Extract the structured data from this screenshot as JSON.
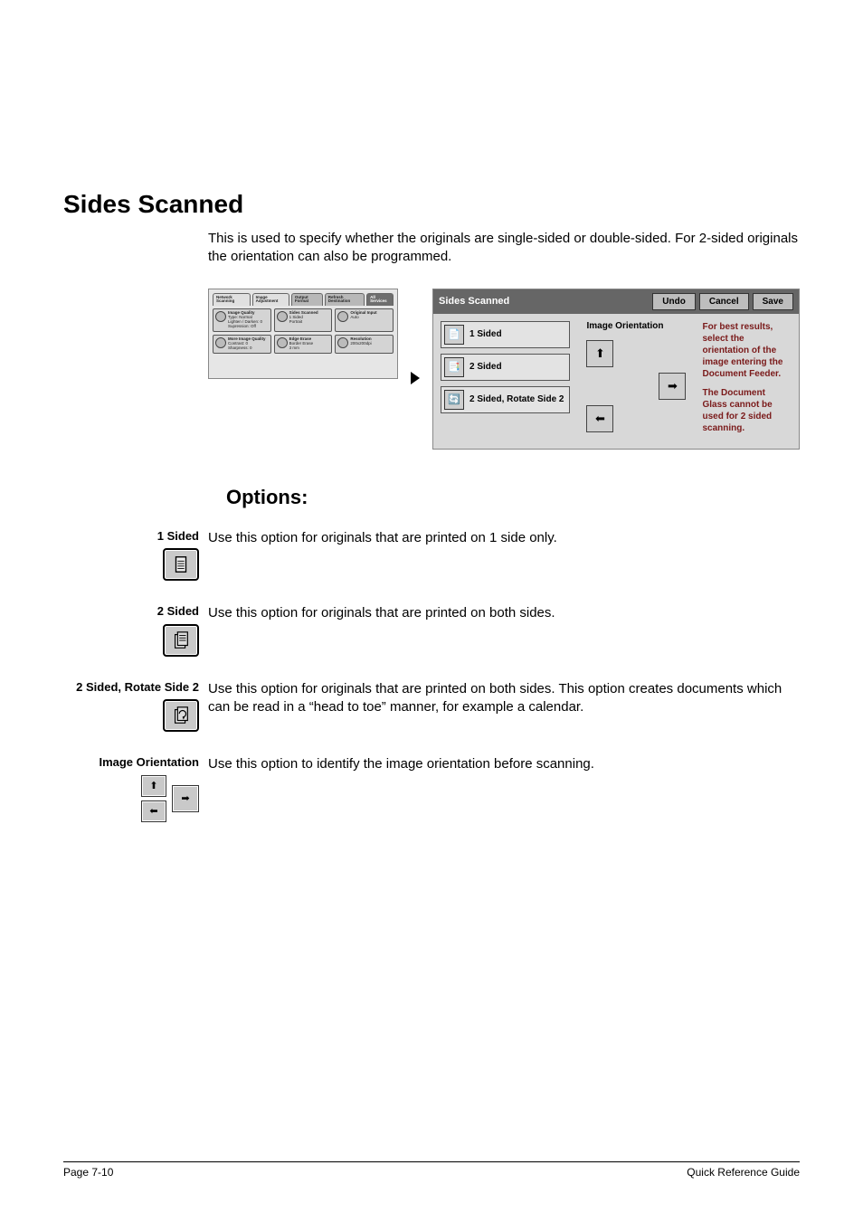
{
  "heading": "Sides Scanned",
  "intro": "This is used to specify whether the originals are single-sided or double-sided. For 2-sided originals the orientation can also be programmed.",
  "left_shot": {
    "tabs": [
      "Network Scanning",
      "Image Adjustment",
      "Output Format",
      "Refresh Destination",
      "All Services"
    ],
    "row1": [
      {
        "title": "Image Quality",
        "lines": [
          "Type: Normal",
          "Lighten / Darken: 0",
          "Supression: Off"
        ]
      },
      {
        "title": "Sides Scanned",
        "lines": [
          "1 Sided",
          "Portrait"
        ]
      },
      {
        "title": "Original Input",
        "lines": [
          "Auto"
        ]
      }
    ],
    "row2": [
      {
        "title": "More Image Quality",
        "lines": [
          "Contrast: 0",
          "Sharpness: 0"
        ]
      },
      {
        "title": "Edge Erase",
        "lines": [
          "Border Erase",
          "3 mm"
        ]
      },
      {
        "title": "Resolution",
        "lines": [
          "200x200dpi"
        ]
      }
    ]
  },
  "right_shot": {
    "title": "Sides Scanned",
    "buttons": {
      "undo": "Undo",
      "cancel": "Cancel",
      "save": "Save"
    },
    "options": [
      "1 Sided",
      "2 Sided",
      "2 Sided, Rotate Side 2"
    ],
    "orientation_title": "Image Orientation",
    "hint1": "For best results, select the orientation of the image entering the Document Feeder.",
    "hint2": "The Document Glass cannot be used for 2 sided scanning."
  },
  "options_heading": "Options:",
  "rows": {
    "one_sided": {
      "label": "1 Sided",
      "desc": "Use this option for originals that are printed on 1 side only."
    },
    "two_sided": {
      "label": "2 Sided",
      "desc": "Use this option for originals that are printed on both sides."
    },
    "rotate": {
      "label": "2 Sided, Rotate Side 2",
      "desc": "Use this option for originals that are printed on both sides. This option creates documents which can be read in a “head to toe” manner, for example a calendar."
    },
    "orientation": {
      "label": "Image Orientation",
      "desc": "Use this option to identify the image orientation before scanning."
    }
  },
  "footer": {
    "left": "Page 7-10",
    "right": "Quick Reference Guide"
  }
}
